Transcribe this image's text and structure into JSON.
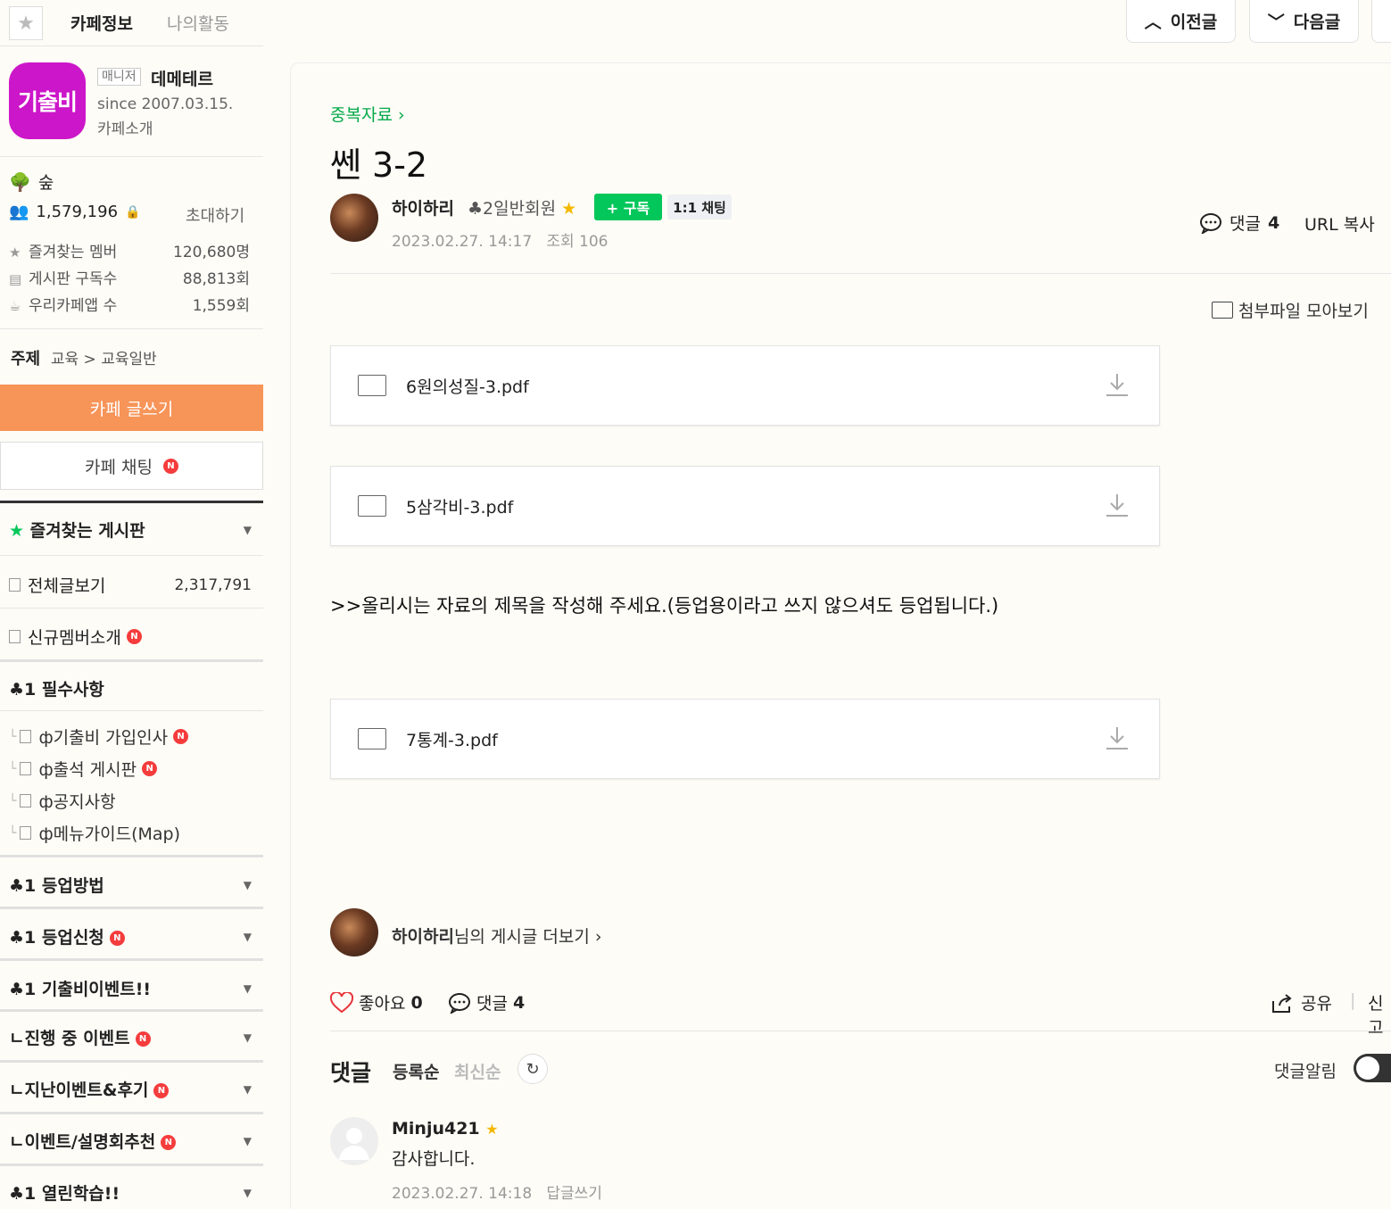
{
  "sidebar": {
    "tabs": [
      "카페정보",
      "나의활동"
    ],
    "manager_badge": "매니저",
    "manager_name": "데메테르",
    "logo_text": "기출비",
    "since": "since 2007.03.15.",
    "cafe_intro": "카페소개",
    "level": "숲",
    "members": "1,579,196",
    "invite": "초대하기",
    "stats": [
      {
        "label": "즐겨찾는 멤버",
        "value": "120,680명"
      },
      {
        "label": "게시판 구독수",
        "value": "88,813회"
      },
      {
        "label": "우리카페앱 수",
        "value": "1,559회"
      }
    ],
    "topic_label": "주제",
    "topic_path": "교육 > 교육일반",
    "write_button": "카페 글쓰기",
    "chat_button": "카페 채팅",
    "badge_new": "N",
    "favorites_title": "즐겨찾는 게시판",
    "all_posts": "전체글보기",
    "all_posts_count": "2,317,791",
    "new_members": "신규멤버소개",
    "section_required": "♣1 필수사항",
    "required_items": [
      "ф기출비 가입인사",
      "ф출석 게시판",
      "ф공지사항",
      "ф메뉴가이드(Map)"
    ],
    "menus": [
      "♣1 등업방법",
      "♣1 등업신청",
      "♣1 기출비이벤트!!",
      "ㄴ진행 중 이벤트",
      "ㄴ지난이벤트&후기",
      "ㄴ이벤트/설명회추천",
      "♣1 열린학습!!"
    ]
  },
  "topnav": {
    "prev": "이전글",
    "next": "다음글"
  },
  "post": {
    "board": "중복자료",
    "title": "쎈 3-2",
    "author": "하이하리",
    "grade": "2일반회원",
    "subscribe": "+ 구독",
    "chat": "1:1 채팅",
    "date": "2023.02.27. 14:17",
    "views_label": "조회",
    "views": "106",
    "comments_label": "댓글",
    "comments_count": "4",
    "url_copy": "URL 복사",
    "attach_all": "첨부파일 모아보기",
    "files": [
      "6원의성질-3.pdf",
      "5삼각비-3.pdf",
      "7통계-3.pdf"
    ],
    "body": ">>올리시는 자료의 제목을 작성해 주세요.(등업용이라고 쓰지 않으셔도 등업됩니다.)",
    "more_author": "하이하리",
    "more_suffix": "님의 게시글 더보기",
    "like_label": "좋아요",
    "like_count": "0",
    "share": "공유",
    "report": "신고"
  },
  "comments": {
    "header": "댓글",
    "sort_register": "등록순",
    "sort_latest": "최신순",
    "alarm": "댓글알림",
    "items": [
      {
        "author": "Minju421",
        "text": "감사합니다.",
        "date": "2023.02.27. 14:18",
        "reply": "답글쓰기"
      }
    ]
  },
  "colors": {
    "accent_green": "#03c75a",
    "write_orange": "#f79458",
    "logo_magenta": "#cc16c9",
    "badge_red": "#f53c3c"
  }
}
